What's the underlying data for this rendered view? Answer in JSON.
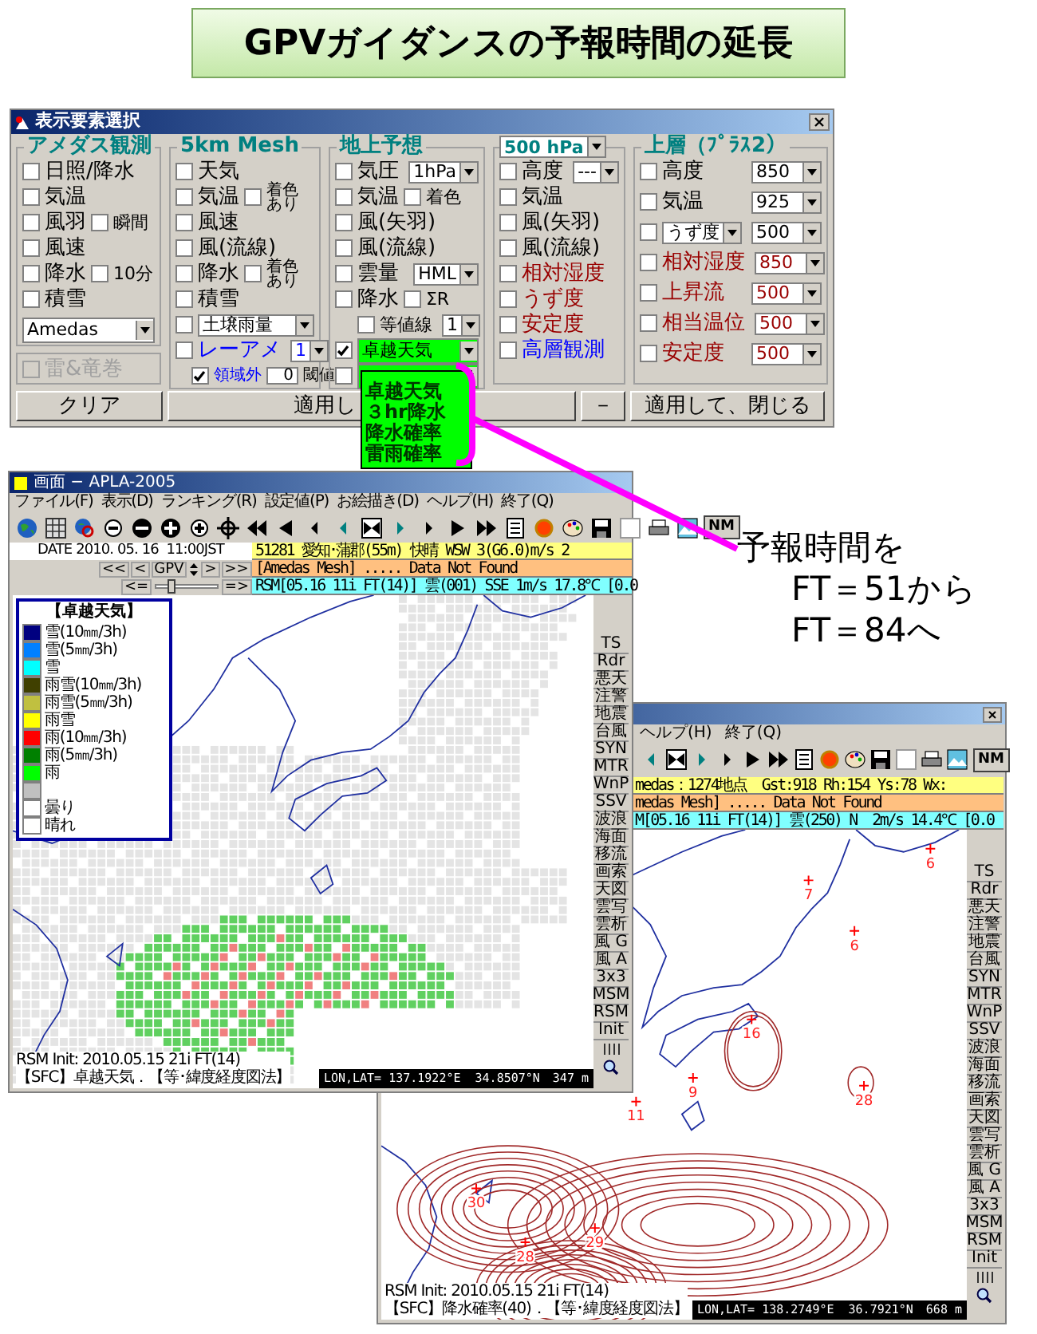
{
  "slide_title": "GPVガイダンスの予報時間の延長",
  "settings_dialog": {
    "title": "表示要素選択",
    "groups": [
      {
        "title": "アメダス観測",
        "rows": [
          {
            "kind": "check",
            "label": "日照/降水",
            "checked": false
          },
          {
            "kind": "check",
            "label": "気温",
            "checked": false
          },
          {
            "kind": "check",
            "label": "風羽",
            "checked": false,
            "sub": {
              "kind": "inline",
              "label": "瞬間",
              "checked": false
            }
          },
          {
            "kind": "check",
            "label": "風速",
            "checked": false
          },
          {
            "kind": "check",
            "label": "降水",
            "checked": false,
            "sub": {
              "kind": "inline",
              "label": "10分",
              "checked": false
            }
          },
          {
            "kind": "check",
            "label": "積雪",
            "checked": false
          },
          {
            "kind": "select",
            "selects": [
              {
                "value": "Amedas"
              }
            ]
          }
        ]
      },
      {
        "title": "5km Mesh",
        "rows": [
          {
            "kind": "check",
            "label": "天気",
            "checked": false
          },
          {
            "kind": "check",
            "label": "気温",
            "checked": false,
            "sub": {
              "kind": "stacked",
              "label": "着色あり",
              "checked": false
            }
          },
          {
            "kind": "check",
            "label": "風速",
            "checked": false
          },
          {
            "kind": "check",
            "label": "風(流線)",
            "checked": false
          },
          {
            "kind": "check",
            "label": "降水",
            "checked": false,
            "sub": {
              "kind": "stacked",
              "label": "着色あり",
              "checked": false
            }
          },
          {
            "kind": "check",
            "label": "積雪",
            "checked": false
          },
          {
            "kind": "check",
            "checked": false,
            "selects": [
              {
                "value": "土壌雨量"
              }
            ]
          },
          {
            "kind": "check",
            "label": "レーアメ",
            "color": "#0000ff",
            "checked": false,
            "selects": [
              {
                "value": "1"
              }
            ]
          },
          {
            "kind": "threshold",
            "label": "領域外",
            "color": "#0000ff",
            "checked": true,
            "value": "0",
            "unit": "閾値"
          }
        ]
      },
      {
        "title": "地上予想",
        "rows": [
          {
            "kind": "check",
            "label": "気圧",
            "checked": false,
            "selects": [
              {
                "value": "1hPa"
              }
            ]
          },
          {
            "kind": "check",
            "label": "気温",
            "checked": false,
            "sub": {
              "kind": "inline",
              "label": "着色",
              "checked": false
            }
          },
          {
            "kind": "check",
            "label": "風(矢羽)",
            "checked": false
          },
          {
            "kind": "check",
            "label": "風(流線)",
            "checked": false
          },
          {
            "kind": "check",
            "label": "雲量",
            "checked": false,
            "selects": [
              {
                "value": "HML"
              }
            ]
          },
          {
            "kind": "check",
            "label": "降水",
            "checked": false,
            "sub": {
              "kind": "inline",
              "label": "ΣR",
              "checked": false
            }
          },
          {
            "kind": "subcheck",
            "label": "等値線",
            "checked": false,
            "selects": [
              {
                "value": "1"
              }
            ]
          },
          {
            "kind": "check",
            "checked": true,
            "selects": [
              {
                "value": "卓越天気",
                "highlighted": true
              }
            ]
          },
          {
            "kind": "check",
            "checked": false,
            "selects": [
              {
                "highlighted": true,
                "open": true
              }
            ]
          }
        ]
      },
      {
        "title_select": "500 hPa",
        "rows": [
          {
            "kind": "check",
            "label": "高度",
            "checked": false,
            "selects": [
              {
                "value": "---"
              }
            ]
          },
          {
            "kind": "check",
            "label": "気温",
            "checked": false
          },
          {
            "kind": "check",
            "label": "風(矢羽)",
            "checked": false
          },
          {
            "kind": "check",
            "label": "風(流線)",
            "checked": false
          },
          {
            "kind": "check",
            "label": "相対湿度",
            "color": "#990000",
            "checked": false
          },
          {
            "kind": "check",
            "label": "うず度",
            "color": "#990000",
            "checked": false
          },
          {
            "kind": "check",
            "label": "安定度",
            "color": "#990000",
            "checked": false
          },
          {
            "kind": "check",
            "label": "高層観測",
            "color": "#0000ff",
            "checked": false
          }
        ]
      },
      {
        "title": "上層（ﾌﾟﾗｽ2）",
        "rows": [
          {
            "kind": "check",
            "label": "高度",
            "checked": false,
            "selects": [
              {
                "value": "850"
              }
            ]
          },
          {
            "kind": "check",
            "label": "気温",
            "checked": false,
            "selects": [
              {
                "value": "925"
              }
            ]
          },
          {
            "kind": "check",
            "checked": false,
            "selects": [
              {
                "value": "うず度"
              },
              {
                "value": "500"
              }
            ]
          },
          {
            "kind": "check",
            "label": "相対湿度",
            "color": "#990000",
            "checked": false,
            "selects": [
              {
                "value": "850"
              }
            ]
          },
          {
            "kind": "check",
            "label": "上昇流",
            "color": "#990000",
            "checked": false,
            "selects": [
              {
                "value": "500"
              }
            ]
          },
          {
            "kind": "check",
            "label": "相当温位",
            "color": "#990000",
            "checked": false,
            "selects": [
              {
                "value": "500"
              }
            ]
          },
          {
            "kind": "check",
            "label": "安定度",
            "color": "#990000",
            "checked": false,
            "selects": [
              {
                "value": "500"
              }
            ]
          }
        ]
      }
    ],
    "disabled_option": {
      "label": "雷&竜巻",
      "checked": false,
      "disabled": true
    },
    "buttons": [
      "クリア",
      "適用し",
      "－",
      "適用して、閉じる"
    ],
    "dropdown_list": [
      "卓越天気",
      "３hr降水",
      "降水確率",
      "雷雨確率"
    ]
  },
  "callout": [
    "予報時間を",
    "FT＝51から",
    "FT＝84へ"
  ],
  "map_window_front": {
    "title": "画面 − APLA-2005",
    "menu": [
      "ファイル(F)",
      "表示(D)",
      "ランキング(R)",
      "設定値(P)",
      "お絵描き(D)",
      "ヘルプ(H)",
      "終了(Q)"
    ],
    "toolbar_label": "NM",
    "date": "DATE 2010. 05. 16  11:00JST",
    "nav": [
      "<<",
      "<",
      "GPV",
      ">",
      ">>"
    ],
    "slider": {
      "ends": [
        "<=",
        "=>"
      ],
      "level": 0.2
    },
    "info_rows": [
      {
        "kind": "amedas",
        "text": "51281 愛知･蒲郡(55m) 快晴 WSW 3(G6.0)m/s 2"
      },
      {
        "kind": "mesh",
        "text": "[Amedas Mesh] ..... Data Not Found"
      },
      {
        "kind": "model",
        "text": "RSM[05.16 11i FT(14)] 雲(001) SSE 1m/s 17.8℃ [0.0"
      }
    ],
    "legend": {
      "title": "【卓越天気】",
      "items": [
        {
          "label": "雪(10㎜/3h)",
          "color": "#000080"
        },
        {
          "label": "雪(5㎜/3h)",
          "color": "#0080ff"
        },
        {
          "label": "雪",
          "color": "#00ffff"
        },
        {
          "label": "雨雪(10㎜/3h)",
          "color": "#404000"
        },
        {
          "label": "雨雪(5㎜/3h)",
          "color": "#c0c040"
        },
        {
          "label": "雨雪",
          "color": "#ffff00"
        },
        {
          "label": "雨(10㎜/3h)",
          "color": "#ff0000"
        },
        {
          "label": "雨(5㎜/3h)",
          "color": "#008000"
        },
        {
          "label": "雨",
          "color": "#00ff00"
        },
        {
          "color": "#c0c0c0"
        },
        {
          "label": "曇り",
          "color": "#ffffff"
        },
        {
          "label": "晴れ",
          "color": "#fffffe"
        }
      ]
    },
    "side_buttons": [
      "TS",
      "Rdr",
      "悪天",
      "注警",
      "地震",
      "台風",
      "SYN",
      "MTR",
      "WnP",
      "SSV",
      "波浪",
      "海面",
      "移流",
      "画索",
      "天図",
      "雲写",
      "雲析",
      "風 G",
      "風 A",
      "3x3",
      "MSM",
      "RSM",
      "Init"
    ],
    "footer": [
      "RSM Init: 2010.05.15 21i FT(14)",
      "【SFC】卓越天気．【等･緯度経度図法】"
    ],
    "status": {
      "position": "LON,LAT= 137.1922°E  34.8507°N",
      "elevation": "347 m"
    }
  },
  "map_window_back": {
    "menu": [
      "ヘルプ(H)",
      "終了(Q)"
    ],
    "toolbar_label": "NM",
    "info_rows": [
      {
        "kind": "amedas",
        "text": "medas：1274地点  Gst:918 Rh:154 Ys:78 Wx:"
      },
      {
        "kind": "mesh",
        "text": "medas Mesh] ..... Data Not Found"
      },
      {
        "kind": "model",
        "text": "M[05.16 11i FT(14)] 雲(250) N  2m/s 14.4℃ [0.0"
      }
    ],
    "map_labels": [
      "16",
      "9",
      "28",
      "30",
      "28",
      "29",
      "11",
      "6",
      "7",
      "6"
    ],
    "side_buttons": [
      "TS",
      "Rdr",
      "悪天",
      "注警",
      "地震",
      "台風",
      "SYN",
      "MTR",
      "WnP",
      "SSV",
      "波浪",
      "海面",
      "移流",
      "画索",
      "天図",
      "雲写",
      "雲析",
      "風 G",
      "風 A",
      "3x3",
      "MSM",
      "RSM",
      "Init"
    ],
    "footer": [
      "RSM Init: 2010.05.15 21i FT(14)",
      "【SFC】降水確率(40)．【等･緯度経度図法】"
    ],
    "status": {
      "position": "LON,LAT= 138.2749°E  36.7921°N",
      "elevation": "668 m"
    }
  }
}
